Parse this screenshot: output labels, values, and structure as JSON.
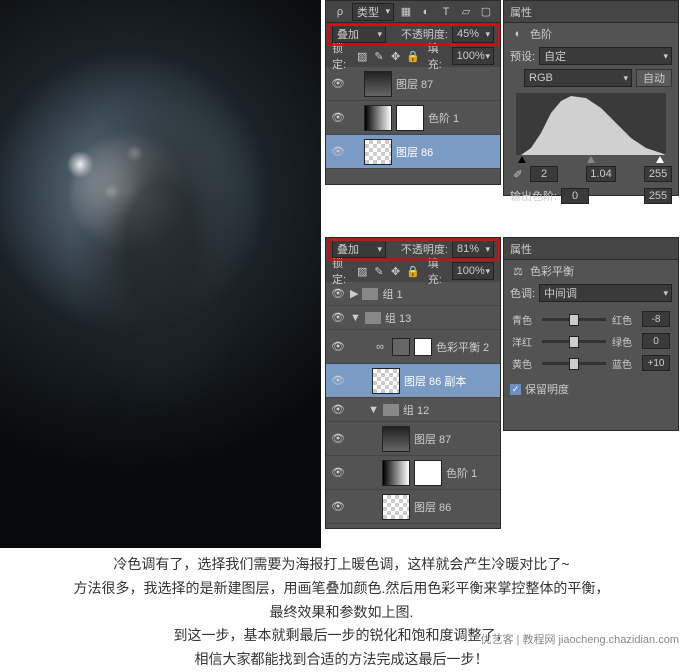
{
  "topLayers": {
    "type_label": "类型",
    "blend_mode": "叠加",
    "opacity_label": "不透明度:",
    "opacity_value": "45%",
    "lock_label": "锁定:",
    "fill_label": "填充:",
    "fill_value": "100%",
    "layers": [
      {
        "name": "图层 87"
      },
      {
        "name": "色阶 1"
      },
      {
        "name": "图层 86"
      }
    ]
  },
  "topProps": {
    "title_tab": "属性",
    "adj_name": "色阶",
    "preset_label": "预设:",
    "preset_value": "自定",
    "channel": "RGB",
    "auto_btn": "自动",
    "shadows": "2",
    "mid": "1.04",
    "highlights": "255",
    "out_label": "输出色阶:",
    "out_lo": "0",
    "out_hi": "255"
  },
  "botLayers": {
    "blend_mode": "叠加",
    "opacity_label": "不透明度:",
    "opacity_value": "81%",
    "lock_label": "锁定:",
    "fill_label": "填充:",
    "fill_value": "100%",
    "items": [
      {
        "name": "组 1",
        "type": "group"
      },
      {
        "name": "组 13",
        "type": "group_open"
      },
      {
        "name": "色彩平衡 2",
        "type": "adj"
      },
      {
        "name": "图层 86 副本",
        "type": "layer_sel"
      },
      {
        "name": "组 12",
        "type": "group_open"
      },
      {
        "name": "图层 87",
        "type": "layer"
      },
      {
        "name": "色阶 1",
        "type": "adj"
      },
      {
        "name": "图层 86",
        "type": "layer"
      }
    ]
  },
  "botProps": {
    "title_tab": "属性",
    "adj_name": "色彩平衡",
    "tone_label": "色调:",
    "tone_value": "中间调",
    "rows": [
      {
        "left": "青色",
        "right": "红色",
        "val": "-8"
      },
      {
        "left": "洋红",
        "right": "绿色",
        "val": "0"
      },
      {
        "left": "黄色",
        "right": "蓝色",
        "val": "+10"
      }
    ],
    "preserve_lum": "保留明度"
  },
  "text": {
    "l1": "冷色调有了，选择我们需要为海报打上暖色调，这样就会产生冷暖对比了~",
    "l2": "方法很多，我选择的是新建图层，用画笔叠加颜色.然后用色彩平衡来掌控整体的平衡，",
    "l3": "最终效果和参数如上图.",
    "l4": "到这一步，基本就剩最后一步的锐化和饱和度调整了，",
    "l5": "相信大家都能找到合适的方法完成这最后一步！"
  },
  "watermark": "优艺客 | 教程网\njiaocheng.chazidian.com"
}
